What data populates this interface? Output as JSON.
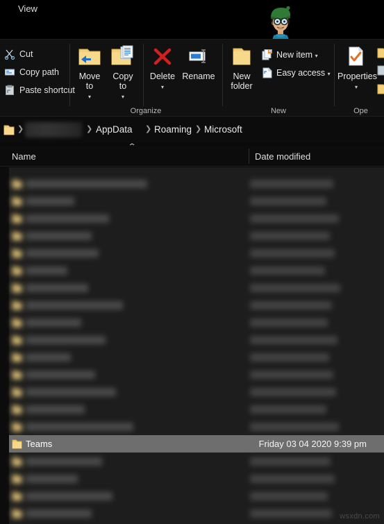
{
  "window": {
    "active_tab": "View",
    "avatar": "cartoon-avatar",
    "watermark": "wsxdn.com"
  },
  "ribbon": {
    "clipboard": {
      "commands": [
        {
          "label": "Cut",
          "icon": "scissors-icon"
        },
        {
          "label": "Copy path",
          "icon": "copy-path-icon"
        },
        {
          "label": "Paste shortcut",
          "icon": "paste-shortcut-icon"
        }
      ]
    },
    "organize": {
      "group_label": "Organize",
      "commands": [
        {
          "label": "Move\nto",
          "icon": "move-to-icon",
          "caret": "▾"
        },
        {
          "label": "Copy\nto",
          "icon": "copy-to-icon",
          "caret": "▾"
        },
        {
          "label": "Delete",
          "icon": "delete-icon",
          "caret": "▾"
        },
        {
          "label": "Rename",
          "icon": "rename-icon",
          "caret": ""
        }
      ]
    },
    "new": {
      "group_label": "New",
      "folder_label": "New\nfolder",
      "folder_icon": "new-folder-icon",
      "commands": [
        {
          "label": "New item",
          "icon": "new-item-icon",
          "caret": "▾"
        },
        {
          "label": "Easy access",
          "icon": "easy-access-icon",
          "caret": "▾"
        }
      ]
    },
    "open": {
      "group_label": "Ope",
      "properties_label": "Properties",
      "properties_icon": "properties-icon",
      "properties_caret": "▾"
    }
  },
  "address": {
    "folder_icon": "folder-icon",
    "separator": "❯",
    "crumbs": [
      {
        "label": "",
        "redacted": true
      },
      {
        "label": "AppData",
        "redacted": false
      },
      {
        "label": "Roaming",
        "redacted": false
      },
      {
        "label": "Microsoft",
        "redacted": false
      }
    ]
  },
  "columns": {
    "name": "Name",
    "date_modified": "Date modified",
    "sort_indicator": "⌃"
  },
  "file_list": {
    "selected_row": {
      "name": "Teams",
      "date_modified": "Friday 03 04 2020 9:39 pm",
      "icon": "folder-icon"
    },
    "blurred_rows_above": 15,
    "blurred_rows_below": 4
  }
}
